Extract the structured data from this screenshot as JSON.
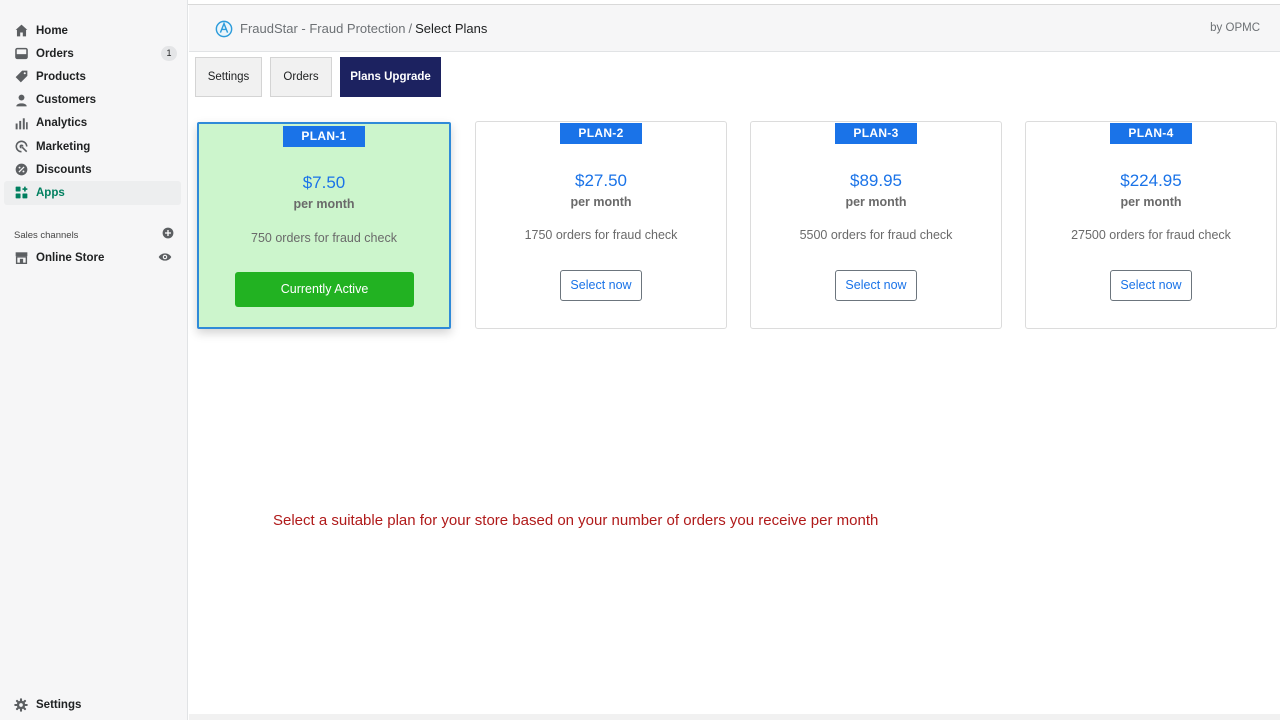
{
  "sidebar": {
    "items": [
      {
        "label": "Home",
        "icon": "home-icon"
      },
      {
        "label": "Orders",
        "icon": "orders-icon",
        "badge": "1"
      },
      {
        "label": "Products",
        "icon": "tag-icon"
      },
      {
        "label": "Customers",
        "icon": "person-icon"
      },
      {
        "label": "Analytics",
        "icon": "bar-chart-icon"
      },
      {
        "label": "Marketing",
        "icon": "target-icon"
      },
      {
        "label": "Discounts",
        "icon": "discount-icon"
      },
      {
        "label": "Apps",
        "icon": "apps-icon",
        "active": true
      }
    ],
    "sales_channels_label": "Sales channels",
    "online_store_label": "Online Store",
    "settings_label": "Settings"
  },
  "header": {
    "app_name": "FraudStar - Fraud Protection",
    "separator": "/",
    "page": "Select Plans",
    "byline": "by OPMC"
  },
  "tabs": [
    {
      "label": "Settings"
    },
    {
      "label": "Orders"
    },
    {
      "label": "Plans Upgrade",
      "active": true
    }
  ],
  "plans": [
    {
      "name": "PLAN-1",
      "price": "$7.50",
      "period": "per month",
      "orders": "750 orders for fraud check",
      "button": "Currently Active",
      "active": true
    },
    {
      "name": "PLAN-2",
      "price": "$27.50",
      "period": "per month",
      "orders": "1750 orders for fraud check",
      "button": "Select now"
    },
    {
      "name": "PLAN-3",
      "price": "$89.95",
      "period": "per month",
      "orders": "5500 orders for fraud check",
      "button": "Select now"
    },
    {
      "name": "PLAN-4",
      "price": "$224.95",
      "period": "per month",
      "orders": "27500 orders for fraud check",
      "button": "Select now"
    }
  ],
  "note": "Select a suitable plan for your store based on your number of orders you receive per month",
  "colors": {
    "accent_blue": "#1a73e8",
    "active_tab": "#1c2260",
    "active_card_bg": "#ccf5cc",
    "active_button": "#22b222",
    "note_red": "#b01a1a",
    "apps_green": "#007f5f"
  }
}
